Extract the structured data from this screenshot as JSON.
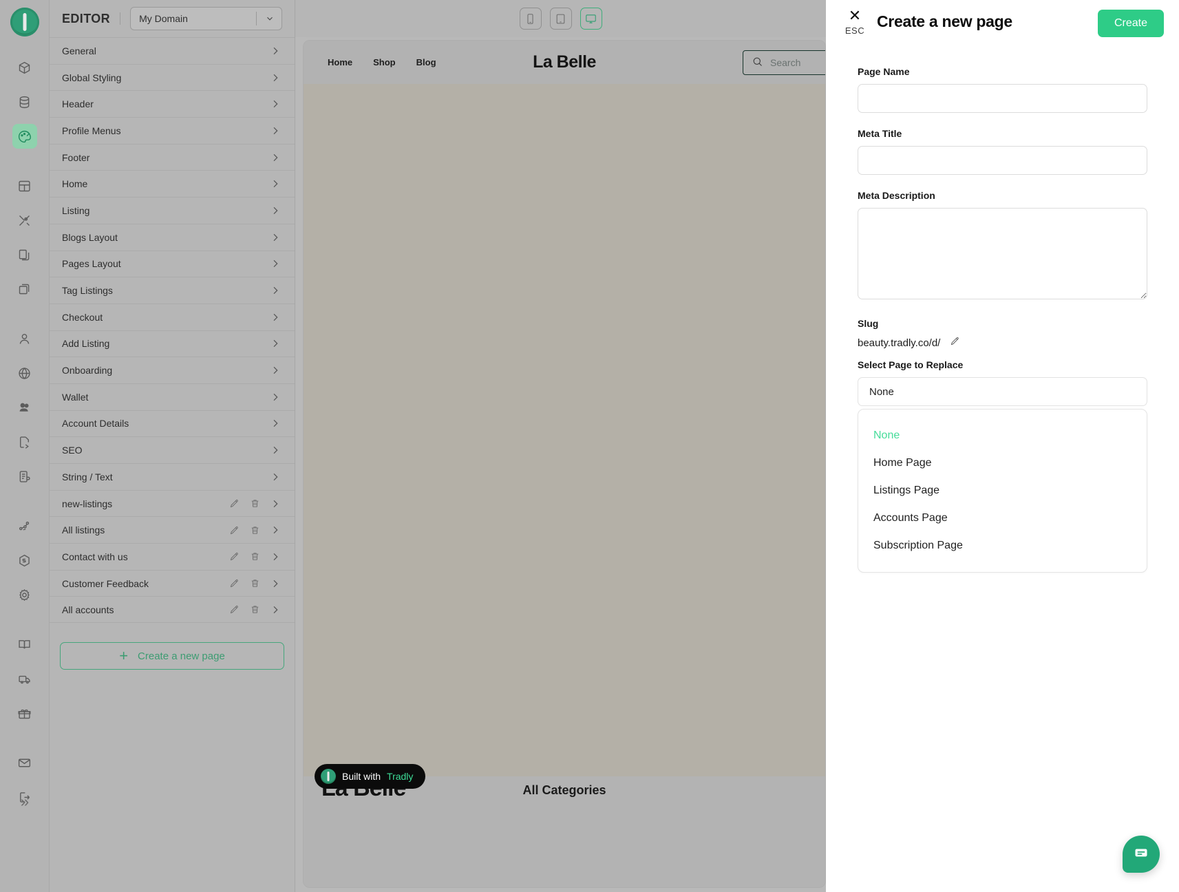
{
  "app": {
    "logo_icon": "tradly-logo-icon",
    "rail_icons": [
      {
        "name": "cube-icon",
        "active": false
      },
      {
        "name": "database-icon",
        "active": false
      },
      {
        "name": "palette-icon",
        "active": true
      },
      {
        "name": "layout-icon",
        "active": false
      },
      {
        "name": "tools-icon",
        "active": false
      },
      {
        "name": "copy-stack-icon",
        "active": false
      },
      {
        "name": "duplicate-icon",
        "active": false
      },
      {
        "name": "user-icon",
        "active": false
      },
      {
        "name": "globe-icon",
        "active": false
      },
      {
        "name": "users-group-icon",
        "active": false
      },
      {
        "name": "file-transfer-icon",
        "active": false
      },
      {
        "name": "document-list-icon",
        "active": false
      },
      {
        "name": "network-nodes-icon",
        "active": false
      },
      {
        "name": "js-badge-icon",
        "active": false
      },
      {
        "name": "gear-icon",
        "active": false
      },
      {
        "name": "book-icon",
        "active": false
      },
      {
        "name": "truck-icon",
        "active": false
      },
      {
        "name": "gift-icon",
        "active": false
      },
      {
        "name": "mail-icon",
        "active": false
      },
      {
        "name": "logout-icon",
        "active": false
      }
    ],
    "collapse_label": "»"
  },
  "editor": {
    "title": "EDITOR",
    "domain_value": "My Domain",
    "items": [
      {
        "label": "General",
        "editable": false
      },
      {
        "label": "Global Styling",
        "editable": false
      },
      {
        "label": "Header",
        "editable": false
      },
      {
        "label": "Profile Menus",
        "editable": false
      },
      {
        "label": "Footer",
        "editable": false
      },
      {
        "label": "Home",
        "editable": false
      },
      {
        "label": "Listing",
        "editable": false
      },
      {
        "label": "Blogs Layout",
        "editable": false
      },
      {
        "label": "Pages Layout",
        "editable": false
      },
      {
        "label": "Tag Listings",
        "editable": false
      },
      {
        "label": "Checkout",
        "editable": false
      },
      {
        "label": "Add Listing",
        "editable": false
      },
      {
        "label": "Onboarding",
        "editable": false
      },
      {
        "label": "Wallet",
        "editable": false
      },
      {
        "label": "Account Details",
        "editable": false
      },
      {
        "label": "SEO",
        "editable": false
      },
      {
        "label": "String / Text",
        "editable": false
      },
      {
        "label": "new-listings",
        "editable": true
      },
      {
        "label": "All listings",
        "editable": true
      },
      {
        "label": "Contact with us",
        "editable": true
      },
      {
        "label": "Customer Feedback",
        "editable": true
      },
      {
        "label": "All accounts",
        "editable": true
      }
    ],
    "create_page_label": "Create a new page",
    "create_page_plus": "+"
  },
  "devices": [
    {
      "name": "mobile-view-button",
      "active": false
    },
    {
      "name": "tablet-view-button",
      "active": false
    },
    {
      "name": "desktop-view-button",
      "active": true
    }
  ],
  "preview": {
    "nav": [
      "Home",
      "Shop",
      "Blog"
    ],
    "brand": "La Belle",
    "search_placeholder": "Search",
    "footer_brand": "La Belle",
    "footer_categories": "All Categories",
    "badge_prefix": "Built with",
    "badge_brand": "Tradly"
  },
  "modal": {
    "esc_label": "ESC",
    "close_glyph": "✕",
    "title": "Create a new page",
    "create_label": "Create",
    "fields": {
      "page_name_label": "Page Name",
      "page_name_value": "",
      "page_name_placeholder": "",
      "meta_title_label": "Meta Title",
      "meta_title_value": "",
      "meta_title_placeholder": "",
      "meta_description_label": "Meta Description",
      "meta_description_value": "",
      "meta_description_placeholder": "",
      "slug_label": "Slug",
      "slug_value": "beauty.tradly.co/d/",
      "select_label": "Select Page to Replace",
      "select_value": "None"
    },
    "dropdown_options": [
      {
        "label": "None",
        "selected": true
      },
      {
        "label": "Home Page",
        "selected": false
      },
      {
        "label": "Listings Page",
        "selected": false
      },
      {
        "label": "Accounts Page",
        "selected": false
      },
      {
        "label": "Subscription Page",
        "selected": false
      }
    ]
  },
  "chat": {
    "icon": "chat-bubble-icon"
  },
  "colors": {
    "accent_green": "#2ecc87",
    "dropdown_selected": "#46dc9a",
    "panel_grey": "#b6b6b6",
    "page_body": "#b4b0a7"
  }
}
